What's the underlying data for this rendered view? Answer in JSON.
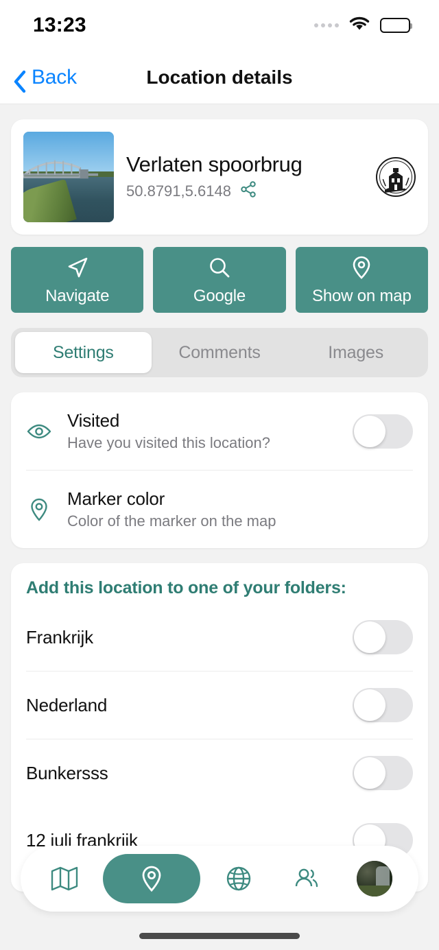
{
  "status_bar": {
    "time": "13:23",
    "cellular_icon": "cellular-dots-icon",
    "wifi_icon": "wifi-icon",
    "battery_icon": "battery-full-icon"
  },
  "nav_bar": {
    "back_label": "Back",
    "back_icon": "chevron-left-icon",
    "title": "Location details"
  },
  "location_card": {
    "thumbnail_alt": "railway bridge over river",
    "title": "Verlaten spoorbrug",
    "coordinates": "50.8791,5.6148",
    "share_icon": "share-icon",
    "badge_alt": "abandoned house logo"
  },
  "actions": [
    {
      "label": "Navigate",
      "icon": "navigation-arrow-icon"
    },
    {
      "label": "Google",
      "icon": "search-icon"
    },
    {
      "label": "Show on map",
      "icon": "map-pin-icon"
    }
  ],
  "tabs": [
    {
      "label": "Settings",
      "active": true
    },
    {
      "label": "Comments",
      "active": false
    },
    {
      "label": "Images",
      "active": false
    }
  ],
  "settings": [
    {
      "title": "Visited",
      "subtitle": "Have you visited this location?",
      "icon": "eye-icon",
      "toggle": "off"
    },
    {
      "title": "Marker color",
      "subtitle": "Color of the marker on the map",
      "icon": "map-pin-icon",
      "toggle": null
    }
  ],
  "folders": {
    "heading": "Add this location to one of your folders:",
    "items": [
      {
        "name": "Frankrijk",
        "toggle": "off"
      },
      {
        "name": "Nederland",
        "toggle": "off"
      },
      {
        "name": "Bunkersss",
        "toggle": "off"
      },
      {
        "name": "12 juli frankrijk",
        "toggle": "off"
      }
    ]
  },
  "bottom_nav": [
    {
      "icon": "map-icon",
      "active": false
    },
    {
      "icon": "map-pin-icon",
      "active": true
    },
    {
      "icon": "globe-icon",
      "active": false
    },
    {
      "icon": "users-icon",
      "active": false
    },
    {
      "icon": "profile-avatar",
      "active": false
    }
  ],
  "colors": {
    "accent": "#499087",
    "accent_text": "#2f7d73",
    "link": "#0a84ff",
    "page_background": "#f2f2f2",
    "card_background": "#ffffff",
    "toggle_track_off": "#e4e4e6",
    "muted_text": "#7b7b80"
  }
}
